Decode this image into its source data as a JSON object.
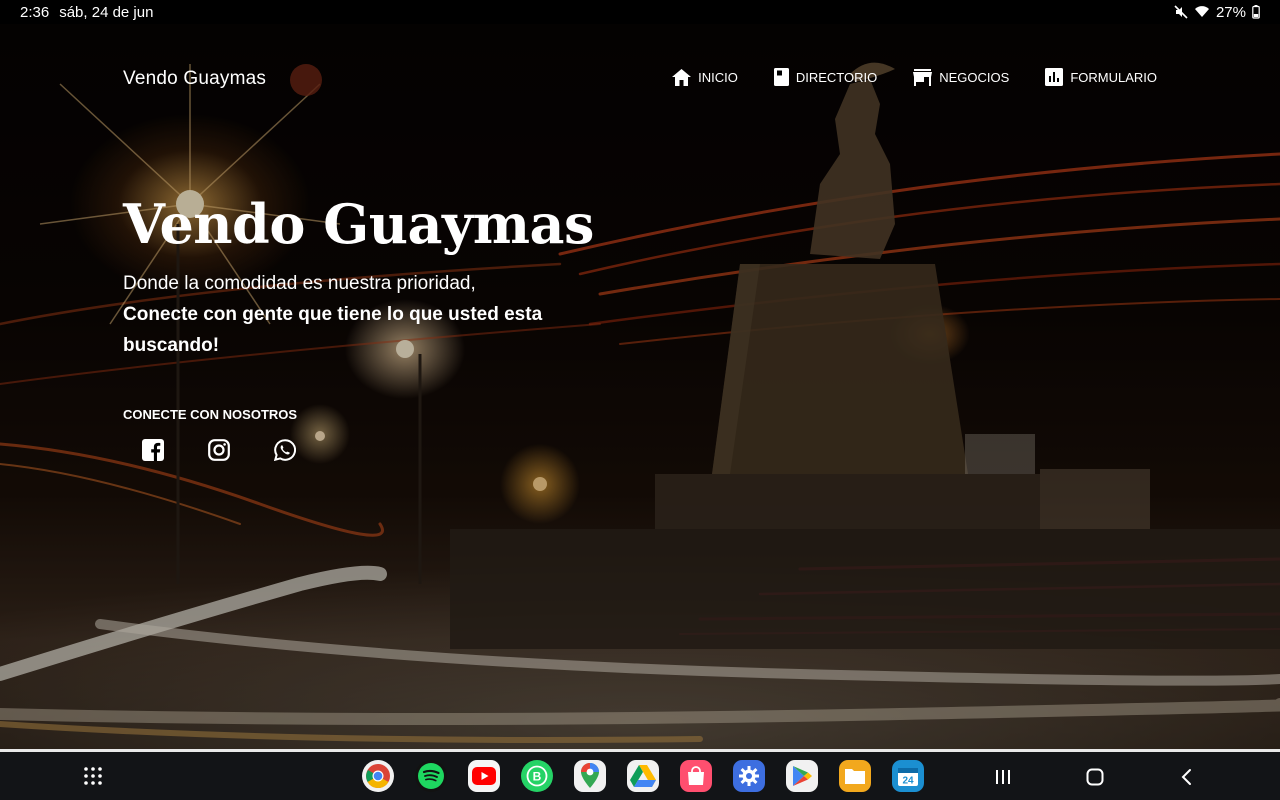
{
  "status_bar": {
    "time": "2:36",
    "date": "sáb, 24 de jun",
    "battery": "27%",
    "icons": [
      "mute-icon",
      "wifi-icon",
      "battery-icon"
    ]
  },
  "navbar": {
    "brand": "Vendo Guaymas",
    "items": [
      {
        "label": "INICIO",
        "icon": "home-icon"
      },
      {
        "label": "DIRECTORIO",
        "icon": "book-icon"
      },
      {
        "label": "NEGOCIOS",
        "icon": "store-icon"
      },
      {
        "label": "FORMULARIO",
        "icon": "chart-icon"
      }
    ]
  },
  "hero": {
    "title": "Vendo Guaymas",
    "subtitle": "Donde la comodidad es nuestra prioridad,",
    "tagline": "Conecte con gente que tiene lo que usted esta buscando!",
    "connect_label": "CONECTE CON NOSOTROS",
    "socials": [
      "facebook-icon",
      "instagram-icon",
      "whatsapp-icon"
    ]
  },
  "taskbar": {
    "apps": [
      "chrome",
      "spotify",
      "youtube",
      "whatsapp-business",
      "maps",
      "drive",
      "galaxy-store",
      "settings",
      "play-store",
      "files",
      "calendar"
    ],
    "calendar_day": "24",
    "business_letter": "B"
  },
  "colors": {
    "accent": "#ffffff",
    "taskbar": "#121417"
  }
}
